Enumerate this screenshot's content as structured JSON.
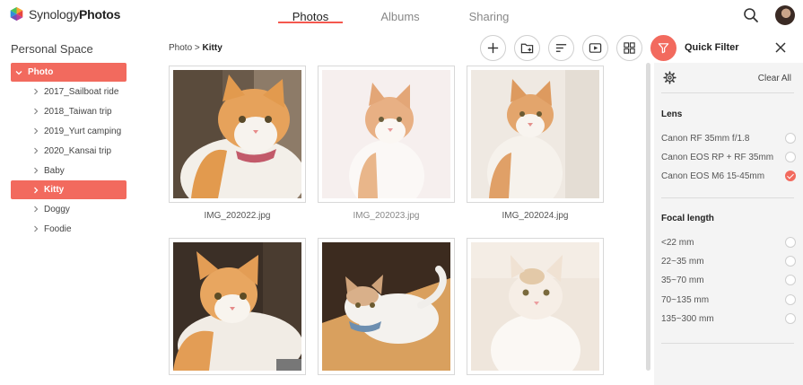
{
  "app": {
    "brand_regular": "Synology",
    "brand_bold": "Photos"
  },
  "tabs": [
    {
      "label": "Photos",
      "active": true
    },
    {
      "label": "Albums",
      "active": false
    },
    {
      "label": "Sharing",
      "active": false
    }
  ],
  "sidebar": {
    "title": "Personal Space",
    "root": "Photo",
    "items": [
      {
        "label": "2017_Sailboat ride",
        "selected": false
      },
      {
        "label": "2018_Taiwan trip",
        "selected": false
      },
      {
        "label": "2019_Yurt camping",
        "selected": false
      },
      {
        "label": "2020_Kansai trip",
        "selected": false
      },
      {
        "label": "Baby",
        "selected": false
      },
      {
        "label": "Kitty",
        "selected": true
      },
      {
        "label": "Doggy",
        "selected": false
      },
      {
        "label": "Foodie",
        "selected": false
      }
    ]
  },
  "breadcrumb": {
    "parent": "Photo",
    "separator": ">",
    "current": "Kitty"
  },
  "toolbar": {
    "quick_filter_label": "Quick Filter",
    "icons": [
      "plus-icon",
      "add-folder-icon",
      "sort-icon",
      "slideshow-icon",
      "grid-view-icon",
      "filter-icon"
    ]
  },
  "photos": [
    {
      "filename": "IMG_202022.jpg"
    },
    {
      "filename": "IMG_202023.jpg"
    },
    {
      "filename": "IMG_202024.jpg"
    },
    {
      "filename": ""
    },
    {
      "filename": ""
    },
    {
      "filename": ""
    }
  ],
  "filter_panel": {
    "clear_all": "Clear All",
    "lens": {
      "title": "Lens",
      "options": [
        {
          "label": "Canon RF 35mm f/1.8",
          "checked": false
        },
        {
          "label": "Canon EOS RP + RF 35mm",
          "checked": false
        },
        {
          "label": "Canon EOS M6 15-45mm",
          "checked": true
        }
      ]
    },
    "focal": {
      "title": "Focal length",
      "options": [
        {
          "label": "<22 mm",
          "checked": false
        },
        {
          "label": "22~35 mm",
          "checked": false
        },
        {
          "label": "35~70 mm",
          "checked": false
        },
        {
          "label": "70~135 mm",
          "checked": false
        },
        {
          "label": "135~300 mm",
          "checked": false
        }
      ]
    }
  },
  "colors": {
    "accent": "#f26a5e",
    "panel_bg": "#f4f4f4"
  }
}
